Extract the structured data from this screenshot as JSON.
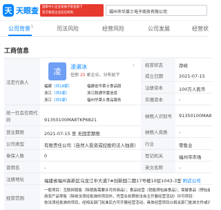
{
  "header": {
    "logo_mark": "天",
    "logo_text": "天眼查",
    "banner_line1": "国家中小企业发展子基金旗下",
    "banner_line2": "官方备案企业征信机构",
    "search_value": "福州市华莱士电子商务有限公司"
  },
  "tabs": [
    {
      "label": "公司背景",
      "count": "5"
    },
    {
      "label": "司法风险",
      "count": ""
    },
    {
      "label": "经营风险",
      "count": ""
    },
    {
      "label": "公司发展",
      "count": ""
    },
    {
      "label": "经营状",
      "count": ""
    }
  ],
  "section_title": "工商信息",
  "legal_rep": {
    "label": "法定代表人",
    "avatar_char": "凌",
    "name": "凌淑冰",
    "sub_prefix": "任职",
    "sub_count": "25",
    "sub_suffix": "家企业，分布如下",
    "regions": [
      {
        "region": "福建",
        "count": "（共18家）",
        "company": "福建省华莱士食品股"
      },
      {
        "region": "浙江",
        "count": "（共5家）",
        "company": "浙江联通华嘉信息"
      },
      {
        "region": "浙江",
        "count": "（共5家）",
        "company": "福州华莱士食品服务"
      }
    ],
    "regions2": [
      {
        "company": "福州华莱士食品服"
      },
      {
        "company": "浙江联通华嘉信息"
      },
      {
        "company": "福州华莱士企业管理"
      }
    ],
    "chevron": "›"
  },
  "fields": {
    "status_label": "经营状态",
    "status_value": "存续",
    "founded_label": "成立日期",
    "founded_value": "2021-07-15",
    "reg_capital_label": "注册资本",
    "reg_capital_value": "100万人民币",
    "paid_capital_label": "实缴资本",
    "paid_capital_value": "-",
    "credit_code_label": "统一社会信用代码",
    "credit_code_value": "91350100MA8TKP6821",
    "taxpayer_id_label": "纳税人识别号",
    "taxpayer_id_value": "91350100MA8",
    "term_label": "营业期限",
    "term_value": "2021-07-15 至 无固定期限",
    "taxpayer_quality_label": "纳税人资质",
    "taxpayer_quality_value": "-",
    "company_type_label": "公司类型",
    "company_type_value": "有限责任公司（自然人投资或控股的法人独资）",
    "industry_label": "行业",
    "industry_value": "零售业",
    "insured_label": "参保人数",
    "insured_value": "0",
    "reg_authority_label": "登记机关",
    "reg_authority_value": "福州市市场",
    "former_name_label": "曾用名",
    "former_name_value": "-",
    "english_name_label": "英文名称",
    "english_name_value": "-",
    "address_label": "注册地址",
    "address_value": "福建省福州高新区乌龙江中大道7#创新园二期17号楼10层1043-3室",
    "nearby_link": "附近公司",
    "scope_label": "经营范围",
    "scope_line1": "一般项目：互联网销售（除销售需要许可的商品）；食品经营（销售预包装食品）；保健食品（预包装）",
    "scope_line2": "用农产品零售（除依法须经批准的项目外，凭营业执照依法自主开展经营活动）许可项目：",
    "scope_line3": "依法须经批准的项目，经相关部门批准后方可开展经营活动，具体经营项目以相关部门批准文件或许可证件为准）",
    "scope_more": "展开"
  }
}
